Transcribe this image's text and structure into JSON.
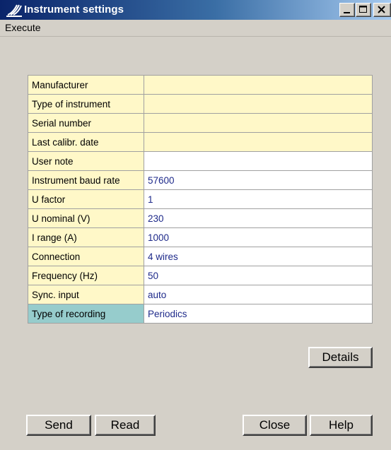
{
  "window": {
    "title": "Instrument settings",
    "icon": "instrument-wave-icon",
    "controls": [
      "minimize-icon",
      "maximize-icon",
      "close-icon"
    ]
  },
  "menu": {
    "items": [
      "Execute"
    ]
  },
  "settings": {
    "rows": [
      {
        "label": "Manufacturer",
        "value": ""
      },
      {
        "label": "Type of instrument",
        "value": ""
      },
      {
        "label": "Serial number",
        "value": ""
      },
      {
        "label": "Last calibr. date",
        "value": ""
      },
      {
        "label": "User note",
        "value": ""
      },
      {
        "label": "Instrument baud rate",
        "value": "57600"
      },
      {
        "label": "U factor",
        "value": "1"
      },
      {
        "label": "U nominal (V)",
        "value": "230"
      },
      {
        "label": "I range (A)",
        "value": "1000"
      },
      {
        "label": "Connection",
        "value": "4 wires"
      },
      {
        "label": "Frequency (Hz)",
        "value": "50"
      },
      {
        "label": "Sync. input",
        "value": "auto"
      },
      {
        "label": "Type of recording",
        "value": "Periodics"
      }
    ]
  },
  "buttons": {
    "details": "Details",
    "send": "Send",
    "read": "Read",
    "close": "Close",
    "help": "Help"
  },
  "colors": {
    "label_bg": "#fff8c8",
    "selected_label_bg": "#96cccc",
    "value_text": "#1e2a8a",
    "dialog_bg": "#d4d0c8"
  }
}
